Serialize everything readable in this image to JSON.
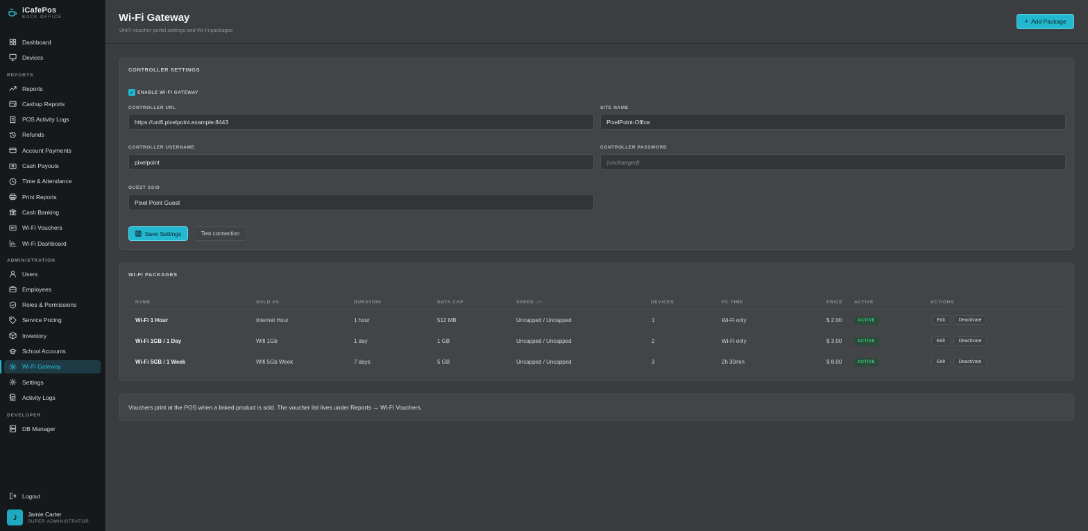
{
  "brand": {
    "name": "iCafePos",
    "subtitle": "BACK OFFICE"
  },
  "nav": {
    "top": [
      {
        "label": "Dashboard",
        "icon": "grid-icon"
      },
      {
        "label": "Devices",
        "icon": "monitor-icon"
      }
    ],
    "reports_title": "REPORTS",
    "reports": [
      {
        "label": "Reports",
        "icon": "trend-icon"
      },
      {
        "label": "Cashup Reports",
        "icon": "wallet-icon"
      },
      {
        "label": "POS Activity Logs",
        "icon": "receipt-icon"
      },
      {
        "label": "Refunds",
        "icon": "history-icon"
      },
      {
        "label": "Account Payments",
        "icon": "card-icon"
      },
      {
        "label": "Cash Payouts",
        "icon": "cash-icon"
      },
      {
        "label": "Time & Attendance",
        "icon": "clock-icon"
      },
      {
        "label": "Print Reports",
        "icon": "printer-icon"
      },
      {
        "label": "Cash Banking",
        "icon": "bank-icon"
      },
      {
        "label": "Wi-Fi Vouchers",
        "icon": "ticket-icon"
      },
      {
        "label": "Wi-Fi Dashboard",
        "icon": "bar-chart-icon"
      }
    ],
    "admin_title": "ADMINISTRATION",
    "admin": [
      {
        "label": "Users",
        "icon": "user-icon"
      },
      {
        "label": "Employees",
        "icon": "briefcase-icon"
      },
      {
        "label": "Roles & Permissions",
        "icon": "shield-icon"
      },
      {
        "label": "Service Pricing",
        "icon": "tag-icon"
      },
      {
        "label": "Inventory",
        "icon": "box-icon"
      },
      {
        "label": "School Accounts",
        "icon": "school-icon"
      },
      {
        "label": "Wi-Fi Gateway",
        "icon": "gear-icon",
        "active": true
      },
      {
        "label": "Settings",
        "icon": "settings-icon"
      },
      {
        "label": "Activity Logs",
        "icon": "log-icon"
      }
    ],
    "dev_title": "DEVELOPER",
    "developer": [
      {
        "label": "DB Manager",
        "icon": "database-icon"
      }
    ],
    "logout": "Logout"
  },
  "user": {
    "initial": "J",
    "name": "Jamie Carter",
    "role": "SUPER ADMINISTRATOR"
  },
  "header": {
    "title": "Wi-Fi Gateway",
    "subtitle": "UniFi voucher portal settings and Wi-Fi packages",
    "add_button": "Add Package"
  },
  "controller": {
    "title": "CONTROLLER SETTINGS",
    "enable_label": "ENABLE WI-FI GATEWAY",
    "enabled": true,
    "url_label": "CONTROLLER URL",
    "url_value": "https://unifi.pixelpoint.example:8443",
    "site_label": "SITE NAME",
    "site_value": "PixelPoint-Office",
    "username_label": "CONTROLLER USERNAME",
    "username_value": "pixelpoint",
    "password_label": "CONTROLLER PASSWORD",
    "password_placeholder": "(unchanged)",
    "ssid_label": "GUEST SSID",
    "ssid_value": "Pixel Point Guest",
    "save_button": "Save Settings",
    "test_button": "Test connection"
  },
  "packages": {
    "title": "WI-FI PACKAGES",
    "columns": [
      "NAME",
      "SOLD AS",
      "DURATION",
      "DATA CAP",
      "SPEED ↓/↑",
      "DEVICES",
      "PC TIME",
      "PRICE",
      "ACTIVE",
      "ACTIONS"
    ],
    "rows": [
      {
        "name": "Wi-Fi 1 Hour",
        "sold_as": "Internet Hour",
        "duration": "1 hour",
        "data_cap": "512 MB",
        "speed": "Uncapped / Uncapped",
        "devices": "1",
        "pc_time": "Wi-Fi only",
        "price": "$ 2.00",
        "active": "ACTIVE",
        "edit": "Edit",
        "deactivate": "Deactivate"
      },
      {
        "name": "Wi-Fi 1GB / 1 Day",
        "sold_as": "Wifi 1Gb",
        "duration": "1 day",
        "data_cap": "1 GB",
        "speed": "Uncapped / Uncapped",
        "devices": "2",
        "pc_time": "Wi-Fi only",
        "price": "$ 3.00",
        "active": "ACTIVE",
        "edit": "Edit",
        "deactivate": "Deactivate"
      },
      {
        "name": "Wi-Fi 5GB / 1 Week",
        "sold_as": "Wifi 5Gb Week",
        "duration": "7 days",
        "data_cap": "5 GB",
        "speed": "Uncapped / Uncapped",
        "devices": "3",
        "pc_time": "2h 30min",
        "price": "$ 8.00",
        "active": "ACTIVE",
        "edit": "Edit",
        "deactivate": "Deactivate"
      }
    ]
  },
  "note": "Vouchers print at the POS when a linked product is sold. The voucher list lives under Reports → Wi-Fi Vouchers.",
  "colors": {
    "accent": "#22b8cf",
    "sidebar": "#16191c",
    "background": "#3a3c3f",
    "active_badge": "#3bcf7e"
  }
}
